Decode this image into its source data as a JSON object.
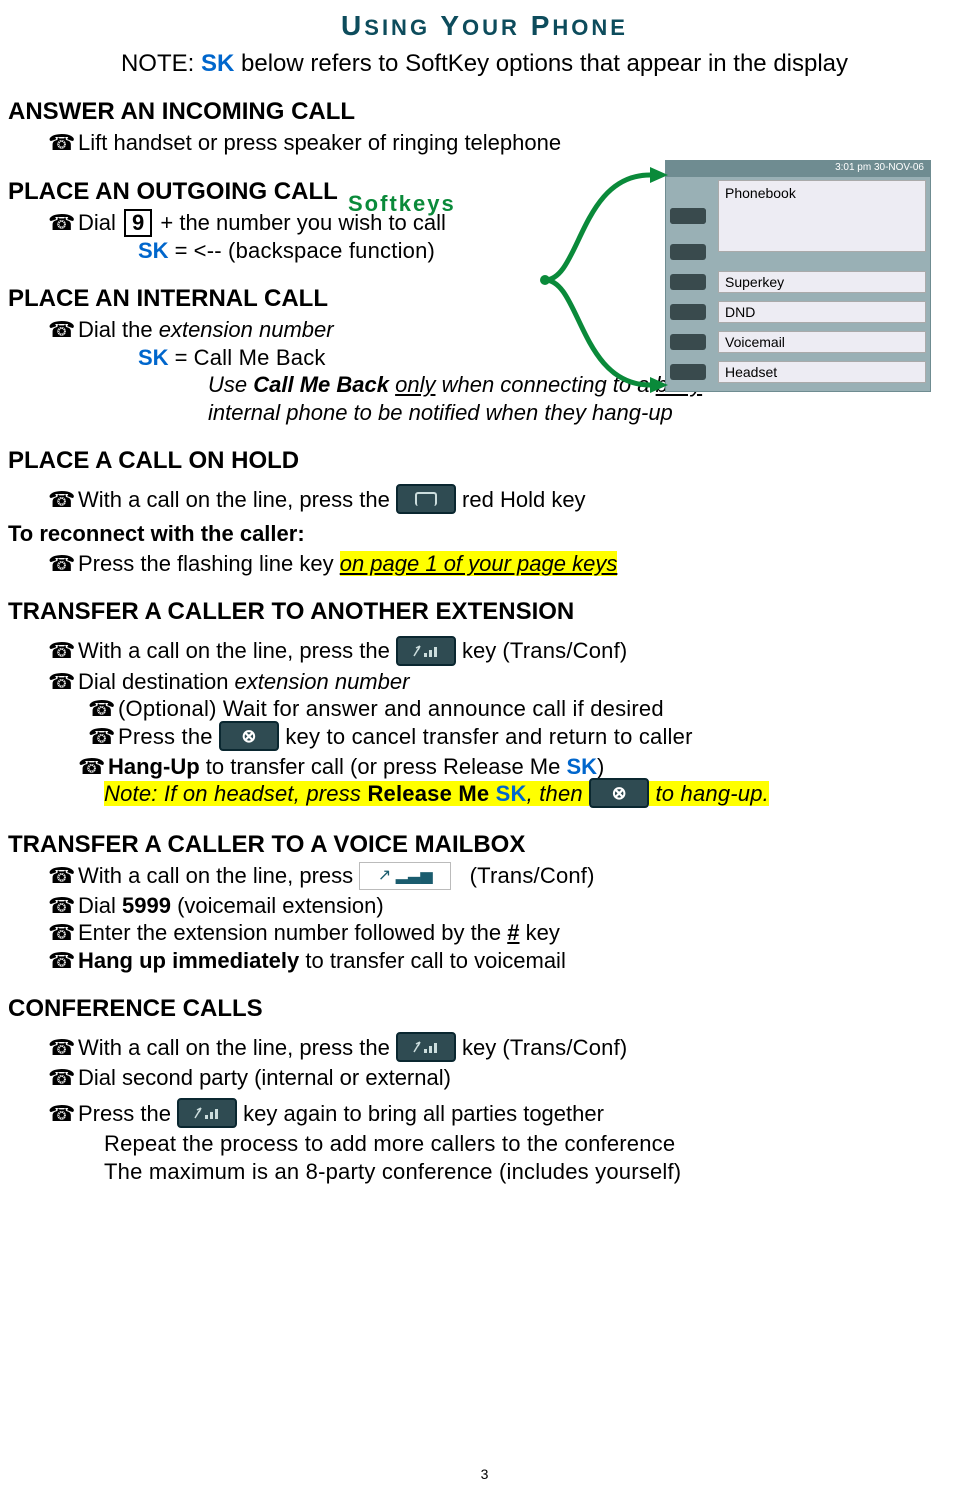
{
  "title_parts": {
    "u": "U",
    "sing": "SING",
    "space": " ",
    "y": "Y",
    "our": "OUR",
    "space2": " ",
    "p": "P",
    "hone": "HONE"
  },
  "note_prefix": "NOTE: ",
  "sk_abbrev": "SK",
  "note_suffix": " below refers to SoftKey options that appear in the display",
  "softkeys_label": "Softkeys",
  "phone_screen": {
    "time_bar": "3:01 pm    30-NOV-06",
    "items": [
      "Phonebook",
      "Superkey",
      "DND",
      "Voicemail",
      "Headset"
    ]
  },
  "sections": {
    "answer": {
      "h": "ANSWER AN INCOMING CALL",
      "line": "Lift handset or press speaker of ringing telephone"
    },
    "outgoing": {
      "h": "PLACE AN OUTGOING CALL",
      "dial_pre": "Dial ",
      "key": "9",
      "dial_post": " + the number you wish to call",
      "sk_eq": " = ",
      "sk_func": "<-- (backspace function)"
    },
    "internal": {
      "h": "PLACE AN INTERNAL CALL",
      "dial": "Dial the ",
      "ext": "extension number",
      "sk_eq": " = ",
      "sk_func": "Call Me Back",
      "tip1a": "Use ",
      "tip1b": "Call Me Back",
      "tip1c": " ",
      "tip1d": "only",
      "tip1e": " when connecting to a ",
      "tip1f": "busy",
      "tip2": "internal phone to be notified when they hang-up"
    },
    "hold": {
      "h": "PLACE A CALL ON HOLD",
      "l1a": "With a call on the line, press the ",
      "l1b": " red Hold key",
      "rec_h": "To reconnect with the caller:",
      "l2a": "Press the flashing line key ",
      "l2b": "on page 1 of your page keys"
    },
    "transfer": {
      "h": "TRANSFER A CALLER TO ANOTHER EXTENSION",
      "l1a": "With a call on the line, press the ",
      "l1b": " key ",
      "l1c": "(Trans/Conf)",
      "l2a": "Dial destination ",
      "l2b": "extension number",
      "l3": "(Optional)  Wait for answer and announce call if desired",
      "l4a": "Press the ",
      "l4b": " key to cancel transfer and return to caller",
      "l5a": "Hang-Up",
      "l5b": " to transfer call (or press Release Me ",
      "l5c": ")",
      "note_a": "Note:  If on headset, press ",
      "note_b": "Release Me ",
      "note_c": ", then ",
      "note_d": " to hang-up."
    },
    "transfer_vm": {
      "h": "TRANSFER A CALLER TO A VOICE MAILBOX",
      "l1a": "With a call on the line, press   ",
      "l1b": "(Trans/Conf)",
      "l2a": "Dial ",
      "l2b": "5999",
      "l2c": " (voicemail extension)",
      "l3a": "Enter the extension number followed by the ",
      "l3b": "#",
      "l3c": " key",
      "l4a": "Hang up immediately",
      "l4b": " to transfer call to voicemail"
    },
    "conference": {
      "h": "CONFERENCE CALLS",
      "l1a": "With a call on the line, press the ",
      "l1b": " key ",
      "l1c": "(Trans/Conf)",
      "l2": "Dial second party (internal or external)",
      "l3a": "Press the ",
      "l3b": " key again to bring all parties together",
      "l4": "Repeat the process to add more callers to the conference",
      "l5": "The maximum is an 8-party conference (includes yourself)"
    }
  },
  "page_num": "3"
}
